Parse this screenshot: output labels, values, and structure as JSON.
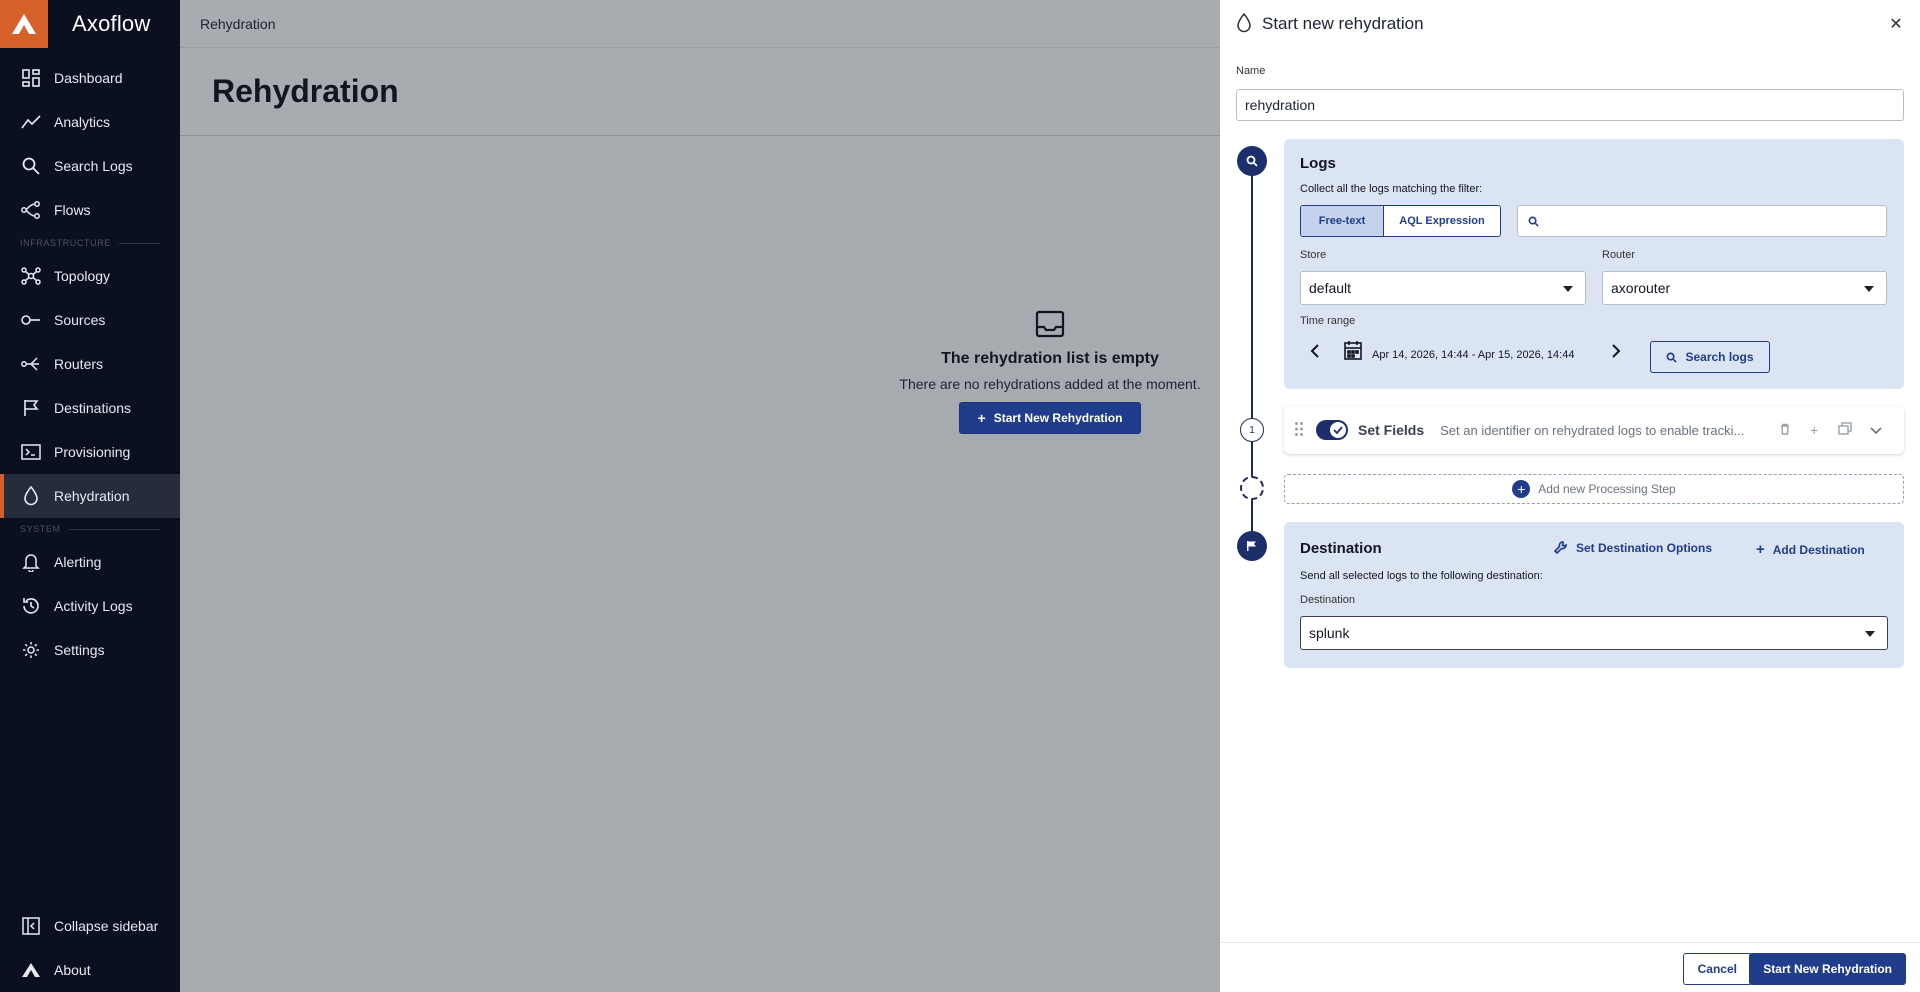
{
  "app": {
    "brand_name": "Axoflow"
  },
  "sidebar": {
    "items": [
      {
        "label": "Dashboard",
        "icon": "dashboard-icon"
      },
      {
        "label": "Analytics",
        "icon": "analytics-icon"
      },
      {
        "label": "Search Logs",
        "icon": "search-icon"
      },
      {
        "label": "Flows",
        "icon": "flows-icon"
      }
    ],
    "section_infrastructure": "INFRASTRUCTURE",
    "infra_items": [
      {
        "label": "Topology",
        "icon": "topology-icon"
      },
      {
        "label": "Sources",
        "icon": "sources-icon"
      },
      {
        "label": "Routers",
        "icon": "routers-icon"
      },
      {
        "label": "Destinations",
        "icon": "flag-icon"
      },
      {
        "label": "Provisioning",
        "icon": "terminal-icon"
      },
      {
        "label": "Rehydration",
        "icon": "droplet-icon",
        "active": true
      }
    ],
    "section_system": "SYSTEM",
    "system_items": [
      {
        "label": "Alerting",
        "icon": "bell-icon"
      },
      {
        "label": "Activity Logs",
        "icon": "history-icon"
      },
      {
        "label": "Settings",
        "icon": "gear-icon"
      }
    ],
    "bottom": {
      "collapse_label": "Collapse sidebar",
      "about_label": "About"
    }
  },
  "main": {
    "breadcrumb": "Rehydration",
    "title": "Rehydration",
    "empty_title": "The rehydration list is empty",
    "empty_sub": "There are no rehydrations added at the moment.",
    "start_button": "Start New Rehydration"
  },
  "panel": {
    "title": "Start new rehydration",
    "name_label": "Name",
    "name_value": "rehydration",
    "logs": {
      "title": "Logs",
      "desc": "Collect all the logs matching the filter:",
      "mode_freetext": "Free-text",
      "mode_aql": "AQL Expression",
      "search_value": "",
      "store_label": "Store",
      "store_value": "default",
      "router_label": "Router",
      "router_value": "axorouter",
      "time_label": "Time range",
      "time_value": "Apr 14, 2026, 14:44 - Apr 15, 2026, 14:44",
      "search_button": "Search logs"
    },
    "step": {
      "number": "1",
      "title": "Set Fields",
      "desc": "Set an identifier on rehydrated logs to enable tracki..."
    },
    "add_step_label": "Add new Processing Step",
    "destination": {
      "title": "Destination",
      "set_options": "Set Destination Options",
      "add_destination": "Add Destination",
      "desc": "Send all selected logs to the following destination:",
      "field_label": "Destination",
      "value": "splunk"
    },
    "footer": {
      "cancel": "Cancel",
      "start": "Start New Rehydration"
    }
  },
  "colors": {
    "accent": "#d6602a",
    "primary": "#1f3d8a",
    "sidebar_bg": "#0b1020",
    "card_bg": "#dbe4f3"
  }
}
